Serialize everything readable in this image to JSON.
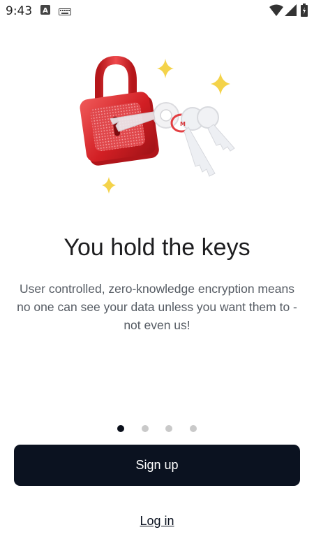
{
  "status_bar": {
    "time": "9:43",
    "icons": [
      "a-notification-icon",
      "keyboard-icon",
      "wifi-icon",
      "signal-icon",
      "battery-icon"
    ]
  },
  "onboarding": {
    "illustration": "padlock-and-keys-icon",
    "title": "You hold the keys",
    "subtitle": "User controlled, zero-knowledge encryption means no one can see your data unless you want them to - not even us!",
    "pagination": {
      "total": 4,
      "current": 1
    }
  },
  "actions": {
    "signup_label": "Sign up",
    "login_label": "Log in"
  },
  "colors": {
    "primary_button": "#0b1220",
    "lock_red": "#d21f24",
    "sparkle_yellow": "#f4d34a",
    "inactive_dot": "#c9c9c9"
  }
}
